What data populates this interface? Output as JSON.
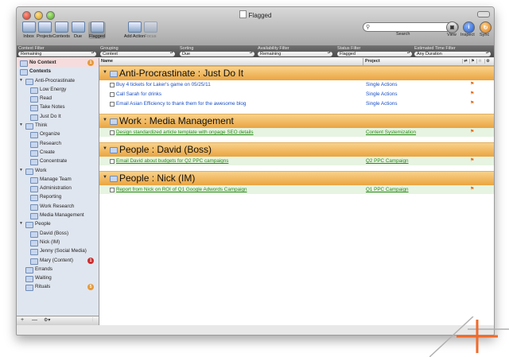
{
  "window": {
    "title": "Flagged"
  },
  "toolbar": {
    "buttons": [
      {
        "label": "Inbox",
        "icon": "inbox-icon"
      },
      {
        "label": "Projects",
        "icon": "projects-icon"
      },
      {
        "label": "Contexts",
        "icon": "contexts-icon"
      },
      {
        "label": "Due",
        "icon": "due-icon"
      },
      {
        "label": "Flagged",
        "icon": "flag-icon",
        "selected": true
      },
      {
        "label": "Add Action",
        "icon": "add-action-icon"
      },
      {
        "label": "Focus",
        "icon": "focus-icon",
        "disabled": true
      }
    ],
    "search_label": "Search",
    "view_label": "View",
    "inspect_label": "Inspect",
    "sync_label": "Sync",
    "inspect_glyph": "i"
  },
  "filters": [
    {
      "header": "Context Filter",
      "value": "Remaining"
    },
    {
      "header": "Grouping",
      "value": "Context"
    },
    {
      "header": "Sorting",
      "value": "Due"
    },
    {
      "header": "Availability Filter",
      "value": "Remaining"
    },
    {
      "header": "Status Filter",
      "value": "Flagged"
    },
    {
      "header": "Estimated Time Filter",
      "value": "Any Duration"
    }
  ],
  "sidebar": {
    "items": [
      {
        "label": "No Context",
        "indent": 0,
        "selected": true,
        "badge": "1",
        "badge_color": "#e59a3c"
      },
      {
        "label": "Contexts",
        "indent": 0,
        "bold": true
      },
      {
        "label": "Anti-Procrastinate",
        "indent": 1,
        "disclosure": "▼"
      },
      {
        "label": "Low Energy",
        "indent": 2
      },
      {
        "label": "Read",
        "indent": 2
      },
      {
        "label": "Take Notes",
        "indent": 2
      },
      {
        "label": "Just Do It",
        "indent": 2
      },
      {
        "label": "Think",
        "indent": 1,
        "disclosure": "▼"
      },
      {
        "label": "Organize",
        "indent": 2
      },
      {
        "label": "Research",
        "indent": 2
      },
      {
        "label": "Create",
        "indent": 2
      },
      {
        "label": "Concentrate",
        "indent": 2
      },
      {
        "label": "Work",
        "indent": 1,
        "disclosure": "▼"
      },
      {
        "label": "Manage Team",
        "indent": 2
      },
      {
        "label": "Administration",
        "indent": 2
      },
      {
        "label": "Reporting",
        "indent": 2
      },
      {
        "label": "Work Research",
        "indent": 2
      },
      {
        "label": "Media Management",
        "indent": 2
      },
      {
        "label": "People",
        "indent": 1,
        "disclosure": "▼"
      },
      {
        "label": "David (Boss)",
        "indent": 2
      },
      {
        "label": "Nick (IM)",
        "indent": 2
      },
      {
        "label": "Jenny (Social Media)",
        "indent": 2
      },
      {
        "label": "Mary (Content)",
        "indent": 2,
        "badge": "1",
        "badge_color": "#cc2d2d"
      },
      {
        "label": "Errands",
        "indent": 1
      },
      {
        "label": "Waiting",
        "indent": 1
      },
      {
        "label": "Rituals",
        "indent": 1,
        "badge": "5",
        "badge_color": "#e59a3c"
      }
    ],
    "bottom": {
      "add": "+",
      "remove": "—",
      "gear": "⚙▾"
    }
  },
  "columns": {
    "name": "Name",
    "project": "Project"
  },
  "groups": [
    {
      "title": "Anti-Procrastinate : Just Do It",
      "style": "blue",
      "tasks": [
        {
          "name": "Buy 4 tickets for Laker's game on 05/25/11",
          "project": "Single Actions"
        },
        {
          "name": "Call Sarah for drinks",
          "project": "Single Actions"
        },
        {
          "name": "Email Asian Efficiency to thank them for the awesome blog",
          "project": "Single Actions"
        }
      ]
    },
    {
      "title": "Work : Media Management",
      "style": "green",
      "tasks": [
        {
          "name": "Design standardized article template with onpage SEO details",
          "project": "Content Systemization"
        }
      ]
    },
    {
      "title": "People : David (Boss)",
      "style": "green",
      "tasks": [
        {
          "name": "Email David about budgets for Q2 PPC campaigns",
          "project": "Q2 PPC Campaign"
        }
      ]
    },
    {
      "title": "People : Nick (IM)",
      "style": "green",
      "tasks": [
        {
          "name": "Report from Nick on ROI of Q1 Google Adwords Campaign",
          "project": "Q1 PPC Campaign"
        }
      ]
    }
  ],
  "colors": {
    "group_header": "#eaa441",
    "blue_text": "#1a4fc4",
    "green_text": "#2a8a1a",
    "flag": "#e06a1a"
  }
}
